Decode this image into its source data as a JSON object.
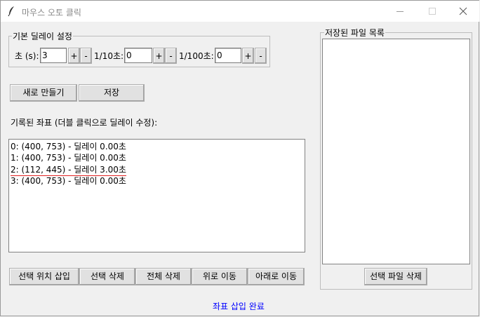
{
  "window": {
    "title": "마우스 오토 클릭",
    "icon": "feather-icon",
    "controls": [
      "minimize-icon",
      "maximize-icon",
      "close-icon"
    ]
  },
  "delay_group": {
    "title": "기본 딜레이 설정",
    "sec_label": "초 (s):",
    "sec_value": "3",
    "tenth_label": "1/10초:",
    "tenth_value": "0",
    "hundredth_label": "1/100초:",
    "hundredth_value": "0",
    "plus": "+",
    "minus": "-"
  },
  "buttons": {
    "new": "새로 만들기",
    "save": "저장"
  },
  "coords": {
    "label": "기록된 좌표 (더블 클릭으로 딜레이 수정):",
    "rows": [
      "0: (400, 753) - 딜레이 0.00초",
      "1: (400, 753) - 딜레이 0.00초",
      "2: (112, 445) - 딜레이 3.00초",
      "3: (400, 753) - 딜레이 0.00초"
    ]
  },
  "actions": {
    "insert": "선택 위치 삽입",
    "delete": "선택 삭제",
    "delete_all": "전체 삭제",
    "move_up": "위로 이동",
    "move_down": "아래로 이동"
  },
  "files": {
    "title": "저장된 파일 목록",
    "delete_button": "선택 파일 삭제"
  },
  "status": {
    "text": "좌표 삽입 완료",
    "color": "#0000ff"
  },
  "colors": {
    "titlebar": "#ffffff",
    "background": "#f0f0f0",
    "highlight_underline": "#e02020"
  }
}
